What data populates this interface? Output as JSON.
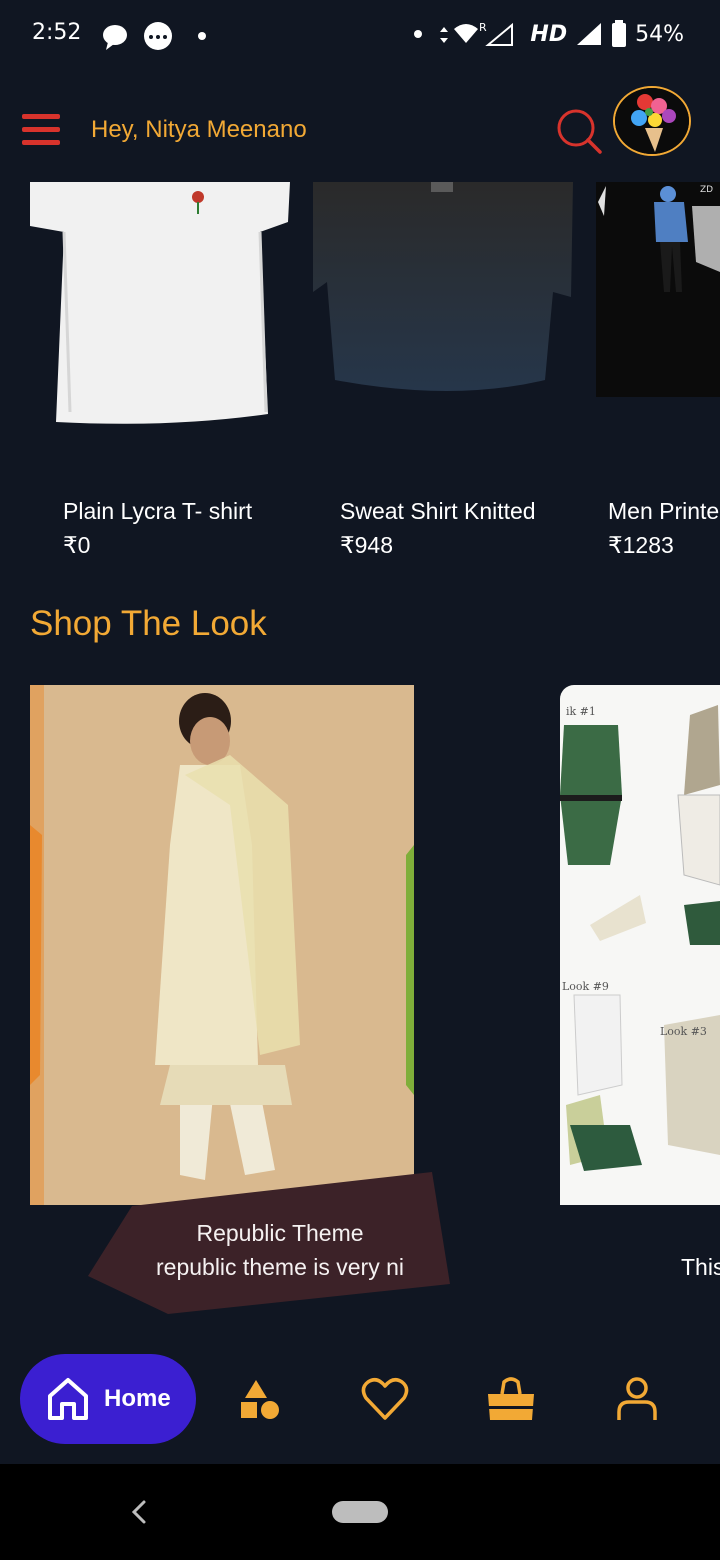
{
  "status_bar": {
    "time": "2:52",
    "network": "HD",
    "battery": "54%"
  },
  "header": {
    "greeting": "Hey, Nitya Meenano",
    "menu_icon": "hamburger-menu-icon",
    "search_icon": "search-icon",
    "avatar": "flower-bouquet-avatar"
  },
  "products": [
    {
      "name": "Plain Lycra T- shirt",
      "price": "₹0"
    },
    {
      "name": "Sweat Shirt Knitted",
      "price": "₹948"
    },
    {
      "name": "Men Printe",
      "price": "₹1283"
    }
  ],
  "shop_the_look": {
    "title": "Shop The Look",
    "looks": [
      {
        "title": "Republic Theme",
        "desc": "republic theme is very ni"
      },
      {
        "title": "",
        "desc": "This"
      }
    ]
  },
  "bottom_nav": {
    "home_label": "Home",
    "items": [
      "home-icon",
      "categories-icon",
      "wishlist-heart-icon",
      "shopping-bag-icon",
      "profile-icon"
    ]
  },
  "colors": {
    "background": "#101622",
    "accent": "#f2a935",
    "menu_red": "#d8332c",
    "home_pill": "#3b1fd1",
    "caption_bg": "#3c2228"
  }
}
